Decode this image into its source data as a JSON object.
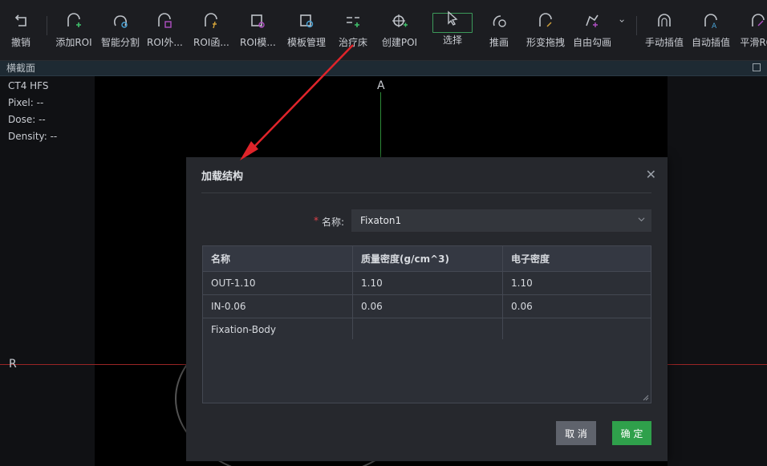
{
  "toolbar": {
    "items": [
      {
        "label": "撤销",
        "icon": "undo-icon"
      },
      {
        "label": "添加ROI",
        "icon": "add-roi-icon"
      },
      {
        "label": "智能分割",
        "icon": "smart-segment-icon"
      },
      {
        "label": "ROI外...",
        "icon": "roi-outer-icon"
      },
      {
        "label": "ROI函...",
        "icon": "roi-function-icon"
      },
      {
        "label": "ROI模...",
        "icon": "roi-template-icon"
      },
      {
        "label": "模板管理",
        "icon": "template-manage-icon"
      },
      {
        "label": "治疗床",
        "icon": "treatment-couch-icon"
      },
      {
        "label": "创建POI",
        "icon": "create-poi-icon"
      },
      {
        "label": "选择",
        "icon": "select-cursor-icon"
      },
      {
        "label": "推画",
        "icon": "push-draw-icon"
      },
      {
        "label": "形变拖拽",
        "icon": "deform-drag-icon"
      },
      {
        "label": "自由勾画",
        "icon": "free-draw-icon"
      },
      {
        "label": "手动插值",
        "icon": "manual-interp-icon"
      },
      {
        "label": "自动插值",
        "icon": "auto-interp-icon"
      },
      {
        "label": "平滑ROI",
        "icon": "smooth-roi-icon"
      }
    ]
  },
  "view": {
    "title": "横截面",
    "info": [
      "CT4 HFS",
      "Pixel: --",
      "Dose: --",
      "Density: --"
    ],
    "label_a": "A",
    "label_r": "R"
  },
  "dialog": {
    "title": "加载结构",
    "name_label": "名称:",
    "name_value": "Fixaton1",
    "columns": [
      "名称",
      "质量密度(g/cm^3)",
      "电子密度"
    ],
    "rows": [
      [
        "OUT-1.10",
        "1.10",
        "1.10"
      ],
      [
        "IN-0.06",
        "0.06",
        "0.06"
      ],
      [
        "Fixation-Body",
        "",
        ""
      ]
    ],
    "cancel_label": "取 消",
    "ok_label": "确 定"
  },
  "colors": {
    "accent_green": "#2fa04b",
    "annotation_red": "#e0242a",
    "required_red": "#e0424a"
  }
}
